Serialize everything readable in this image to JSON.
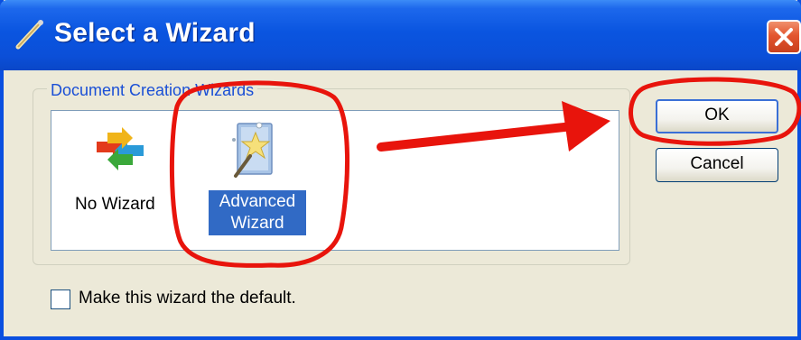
{
  "window": {
    "title": "Select a Wizard",
    "title_icon": "pencil-icon",
    "close_icon": "close-icon",
    "titlebar_color": "#0a55e0",
    "close_color": "#e3552f"
  },
  "group": {
    "label": "Document Creation Wizards",
    "items": [
      {
        "label": "No Wizard",
        "icon": "arrows-icon",
        "selected": false
      },
      {
        "label": "Advanced Wizard",
        "label_lines": [
          "Advanced",
          "Wizard"
        ],
        "icon": "magic-wand-icon",
        "selected": true
      }
    ]
  },
  "buttons": {
    "ok": "OK",
    "cancel": "Cancel"
  },
  "checkbox": {
    "label": "Make this wizard the default.",
    "checked": false
  },
  "annotations": {
    "color": "#e8140c"
  }
}
